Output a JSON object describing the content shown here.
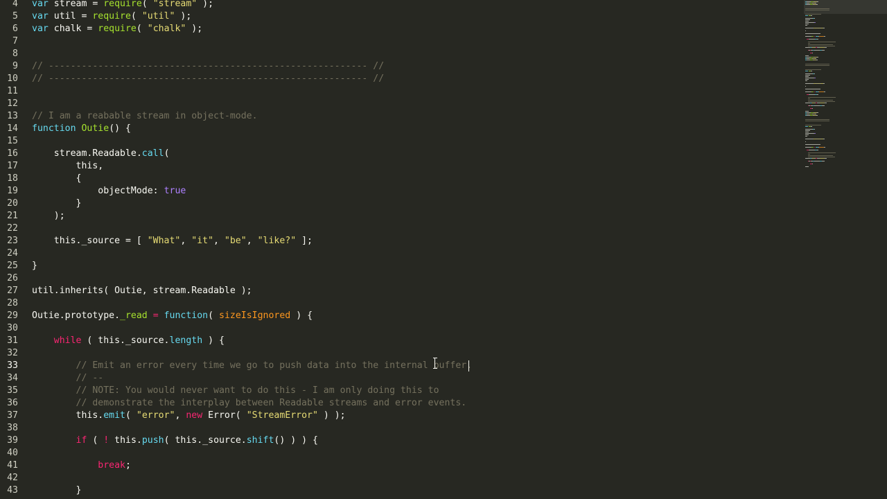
{
  "editor": {
    "cursor_line": "33",
    "lines": [
      {
        "n": "4",
        "tokens": [
          [
            "kw",
            "var"
          ],
          [
            "pl",
            " stream = "
          ],
          [
            "fn",
            "require"
          ],
          [
            "pl",
            "( "
          ],
          [
            "str",
            "\"stream\""
          ],
          [
            "pl",
            " );"
          ]
        ]
      },
      {
        "n": "5",
        "tokens": [
          [
            "kw",
            "var"
          ],
          [
            "pl",
            " util = "
          ],
          [
            "fn",
            "require"
          ],
          [
            "pl",
            "( "
          ],
          [
            "str",
            "\"util\""
          ],
          [
            "pl",
            " );"
          ]
        ]
      },
      {
        "n": "6",
        "tokens": [
          [
            "kw",
            "var"
          ],
          [
            "pl",
            " chalk = "
          ],
          [
            "fn",
            "require"
          ],
          [
            "pl",
            "( "
          ],
          [
            "str",
            "\"chalk\""
          ],
          [
            "pl",
            " );"
          ]
        ]
      },
      {
        "n": "7",
        "tokens": []
      },
      {
        "n": "8",
        "tokens": []
      },
      {
        "n": "9",
        "tokens": [
          [
            "cm",
            "// ---------------------------------------------------------- //"
          ]
        ]
      },
      {
        "n": "10",
        "tokens": [
          [
            "cm",
            "// ---------------------------------------------------------- //"
          ]
        ]
      },
      {
        "n": "11",
        "tokens": []
      },
      {
        "n": "12",
        "tokens": []
      },
      {
        "n": "13",
        "tokens": [
          [
            "cm",
            "// I am a reabable stream in object-mode."
          ]
        ]
      },
      {
        "n": "14",
        "tokens": [
          [
            "kw",
            "function"
          ],
          [
            "pl",
            " "
          ],
          [
            "fn",
            "Outie"
          ],
          [
            "pl",
            "() {"
          ]
        ]
      },
      {
        "n": "15",
        "tokens": []
      },
      {
        "n": "16",
        "tokens": [
          [
            "pl",
            "    stream.Readable."
          ],
          [
            "kw",
            "call"
          ],
          [
            "pl",
            "("
          ]
        ]
      },
      {
        "n": "17",
        "tokens": [
          [
            "pl",
            "        this,"
          ]
        ]
      },
      {
        "n": "18",
        "tokens": [
          [
            "pl",
            "        {"
          ]
        ]
      },
      {
        "n": "19",
        "tokens": [
          [
            "pl",
            "            objectMode: "
          ],
          [
            "num",
            "true"
          ]
        ]
      },
      {
        "n": "20",
        "tokens": [
          [
            "pl",
            "        }"
          ]
        ]
      },
      {
        "n": "21",
        "tokens": [
          [
            "pl",
            "    );"
          ]
        ]
      },
      {
        "n": "22",
        "tokens": []
      },
      {
        "n": "23",
        "tokens": [
          [
            "pl",
            "    this._source = [ "
          ],
          [
            "str",
            "\"What\""
          ],
          [
            "pl",
            ", "
          ],
          [
            "str",
            "\"it\""
          ],
          [
            "pl",
            ", "
          ],
          [
            "str",
            "\"be\""
          ],
          [
            "pl",
            ", "
          ],
          [
            "str",
            "\"like?\""
          ],
          [
            "pl",
            " ];"
          ]
        ]
      },
      {
        "n": "24",
        "tokens": []
      },
      {
        "n": "25",
        "tokens": [
          [
            "pl",
            "}"
          ]
        ]
      },
      {
        "n": "26",
        "tokens": []
      },
      {
        "n": "27",
        "tokens": [
          [
            "pl",
            "util.inherits( Outie, stream.Readable );"
          ]
        ]
      },
      {
        "n": "28",
        "tokens": []
      },
      {
        "n": "29",
        "tokens": [
          [
            "pl",
            "Outie.prototype."
          ],
          [
            "fn",
            "_read"
          ],
          [
            "pl",
            " "
          ],
          [
            "kwr",
            "="
          ],
          [
            "pl",
            " "
          ],
          [
            "kw",
            "function"
          ],
          [
            "pl",
            "( "
          ],
          [
            "arg",
            "sizeIsIgnored"
          ],
          [
            "pl",
            " ) {"
          ]
        ]
      },
      {
        "n": "30",
        "tokens": []
      },
      {
        "n": "31",
        "tokens": [
          [
            "pl",
            "    "
          ],
          [
            "kwr",
            "while"
          ],
          [
            "pl",
            " ( this._source."
          ],
          [
            "kw",
            "length"
          ],
          [
            "pl",
            " ) {"
          ]
        ]
      },
      {
        "n": "32",
        "tokens": []
      },
      {
        "n": "33",
        "tokens": [
          [
            "pl",
            "        "
          ],
          [
            "cm",
            "// Emit an error every time we go to push data into the internal buffer."
          ]
        ]
      },
      {
        "n": "34",
        "tokens": [
          [
            "pl",
            "        "
          ],
          [
            "cm",
            "// --"
          ]
        ]
      },
      {
        "n": "35",
        "tokens": [
          [
            "pl",
            "        "
          ],
          [
            "cm",
            "// NOTE: You would never want to do this - I am only doing this to"
          ]
        ]
      },
      {
        "n": "36",
        "tokens": [
          [
            "pl",
            "        "
          ],
          [
            "cm",
            "// demonstrate the interplay between Readable streams and error events."
          ]
        ]
      },
      {
        "n": "37",
        "tokens": [
          [
            "pl",
            "        this."
          ],
          [
            "kw",
            "emit"
          ],
          [
            "pl",
            "( "
          ],
          [
            "str",
            "\"error\""
          ],
          [
            "pl",
            ", "
          ],
          [
            "kwr",
            "new"
          ],
          [
            "pl",
            " Error( "
          ],
          [
            "str",
            "\"StreamError\""
          ],
          [
            "pl",
            " ) );"
          ]
        ]
      },
      {
        "n": "38",
        "tokens": []
      },
      {
        "n": "39",
        "tokens": [
          [
            "pl",
            "        "
          ],
          [
            "kwr",
            "if"
          ],
          [
            "pl",
            " ( "
          ],
          [
            "kwr",
            "!"
          ],
          [
            "pl",
            " this."
          ],
          [
            "kw",
            "push"
          ],
          [
            "pl",
            "( this._source."
          ],
          [
            "kw",
            "shift"
          ],
          [
            "pl",
            "() ) ) {"
          ]
        ]
      },
      {
        "n": "40",
        "tokens": []
      },
      {
        "n": "41",
        "tokens": [
          [
            "pl",
            "            "
          ],
          [
            "kwr",
            "break"
          ],
          [
            "pl",
            ";"
          ]
        ]
      },
      {
        "n": "42",
        "tokens": []
      },
      {
        "n": "43",
        "tokens": [
          [
            "pl",
            "        }"
          ]
        ]
      }
    ]
  },
  "colors": {
    "background": "#272822",
    "keyword": "#66d9ef",
    "operator": "#f92672",
    "string": "#e6db74",
    "function": "#a6e22e",
    "comment": "#75715e",
    "constant": "#ae81ff",
    "argument": "#fd971f"
  },
  "minimap": {
    "present": true
  }
}
